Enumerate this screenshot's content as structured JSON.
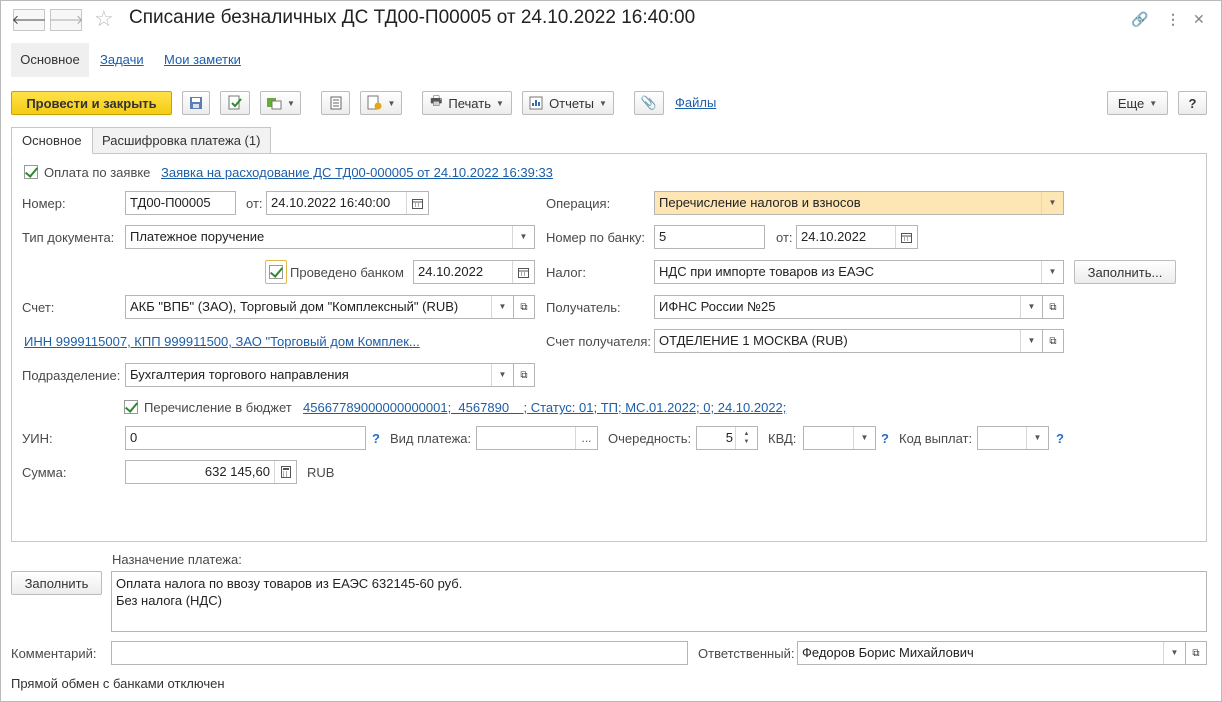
{
  "title": "Списание безналичных ДС ТД00-П00005 от 24.10.2022 16:40:00",
  "nav_tabs": [
    "Основное",
    "Задачи",
    "Мои заметки"
  ],
  "toolbar": {
    "post_close": "Провести и закрыть",
    "print": "Печать",
    "reports": "Отчеты",
    "files": "Файлы",
    "more": "Еще",
    "help": "?"
  },
  "form_tabs": [
    "Основное",
    "Расшифровка платежа (1)"
  ],
  "request": {
    "label": "Оплата по заявке",
    "link": "Заявка на расходование ДС ТД00-000005 от 24.10.2022 16:39:33"
  },
  "number": {
    "label": "Номер:",
    "value": "ТД00-П00005",
    "from_label": "от:",
    "date": "24.10.2022 16:40:00"
  },
  "operation": {
    "label": "Операция:",
    "value": "Перечисление налогов и взносов"
  },
  "doc_type": {
    "label": "Тип документа:",
    "value": "Платежное поручение"
  },
  "bank_number": {
    "label": "Номер по банку:",
    "value": "5",
    "from_label": "от:",
    "date": "24.10.2022"
  },
  "bank_posted": {
    "label": "Проведено банком",
    "date": "24.10.2022"
  },
  "tax": {
    "label": "Налог:",
    "value": "НДС при импорте товаров из ЕАЭС",
    "fill": "Заполнить..."
  },
  "account": {
    "label": "Счет:",
    "value": "АКБ \"ВПБ\" (ЗАО), Торговый дом \"Комплексный\" (RUB)"
  },
  "recipient": {
    "label": "Получатель:",
    "value": "ИФНС России №25"
  },
  "inn_link": "ИНН 9999115007, КПП 999911500, ЗАО \"Торговый дом Комплек...",
  "recipient_account": {
    "label": "Счет получателя:",
    "value": "ОТДЕЛЕНИЕ 1 МОСКВА (RUB)"
  },
  "department": {
    "label": "Подразделение:",
    "value": "Бухгалтерия торгового направления"
  },
  "budget": {
    "label": "Перечисление в бюджет",
    "link": "45667789000000000001;  4567890    ; Статус: 01; ТП; МС.01.2022; 0; 24.10.2022;"
  },
  "uin": {
    "label": "УИН:",
    "value": "0"
  },
  "payment_kind": {
    "label": "Вид платежа:",
    "value": "",
    "btn": "..."
  },
  "priority": {
    "label": "Очередность:",
    "value": "5"
  },
  "kvd": {
    "label": "КВД:",
    "value": ""
  },
  "pay_code": {
    "label": "Код выплат:",
    "value": ""
  },
  "amount": {
    "label": "Сумма:",
    "value": "632 145,60",
    "currency": "RUB"
  },
  "purpose": {
    "label": "Назначение платежа:",
    "fill": "Заполнить",
    "lines": [
      "Оплата налога по ввозу товаров из ЕАЭС 632145-60 руб.",
      "Без налога (НДС)"
    ]
  },
  "comment": {
    "label": "Комментарий:",
    "value": ""
  },
  "responsible": {
    "label": "Ответственный:",
    "value": "Федоров Борис Михайлович"
  },
  "status_text": "Прямой обмен с банками отключен",
  "colors": {
    "primary": "#f5cc14",
    "highlight": "#fde6b3",
    "link": "#1c5ea8"
  }
}
